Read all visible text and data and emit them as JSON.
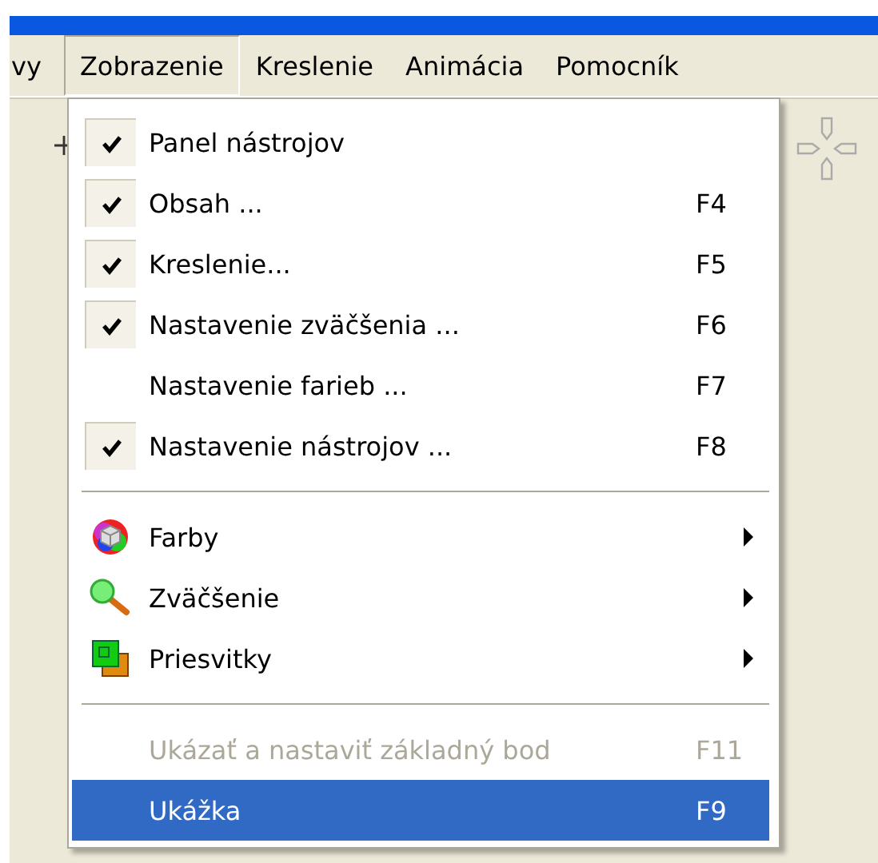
{
  "menubar": [
    {
      "label": "vy",
      "selected": false
    },
    {
      "label": "Zobrazenie",
      "selected": true
    },
    {
      "label": "Kreslenie",
      "selected": false
    },
    {
      "label": "Animácia",
      "selected": false
    },
    {
      "label": "Pomocník",
      "selected": false
    }
  ],
  "menu": {
    "items": [
      {
        "kind": "check",
        "label": "Panel nástrojov",
        "checked": true
      },
      {
        "kind": "check",
        "label": "Obsah ...",
        "shortcut": "F4",
        "checked": true
      },
      {
        "kind": "check",
        "label": "Kreslenie...",
        "shortcut": "F5",
        "checked": true
      },
      {
        "kind": "check",
        "label": "Nastavenie zväčšenia ...",
        "shortcut": "F6",
        "checked": true
      },
      {
        "kind": "check",
        "label": "Nastavenie farieb ...",
        "shortcut": "F7",
        "checked": false
      },
      {
        "kind": "check",
        "label": "Nastavenie nástrojov ...",
        "shortcut": "F8",
        "checked": true
      },
      {
        "kind": "separator"
      },
      {
        "kind": "submenu",
        "label": "Farby"
      },
      {
        "kind": "submenu",
        "label": "Zväčšenie"
      },
      {
        "kind": "submenu",
        "label": "Priesvitky"
      },
      {
        "kind": "separator"
      },
      {
        "kind": "command",
        "label": "Ukázať a nastaviť základný bod",
        "shortcut": "F11",
        "disabled": true,
        "selected": false
      },
      {
        "kind": "command",
        "label": "Ukážka",
        "shortcut": "F9",
        "disabled": false,
        "selected": true
      }
    ]
  }
}
